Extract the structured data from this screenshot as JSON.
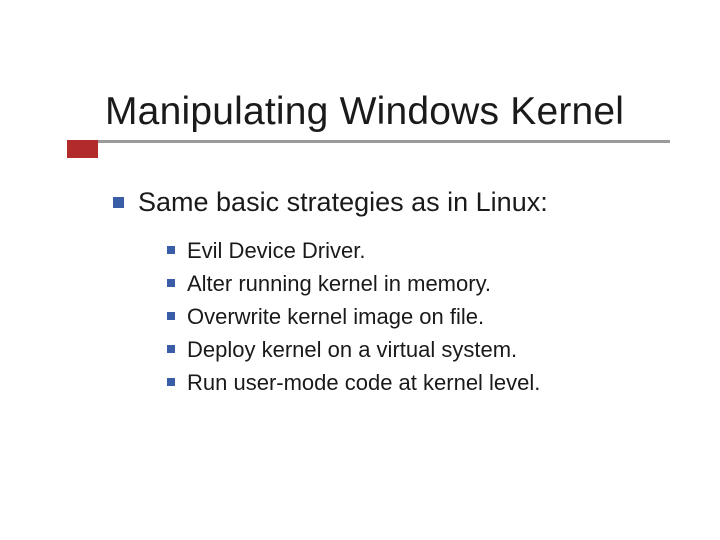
{
  "slide": {
    "title": "Manipulating Windows Kernel",
    "level1_text": "Same basic strategies as in Linux:",
    "level2": [
      "Evil Device Driver.",
      "Alter running kernel in memory.",
      "Overwrite kernel image on file.",
      "Deploy kernel on a virtual system.",
      "Run user-mode code at kernel level."
    ]
  }
}
